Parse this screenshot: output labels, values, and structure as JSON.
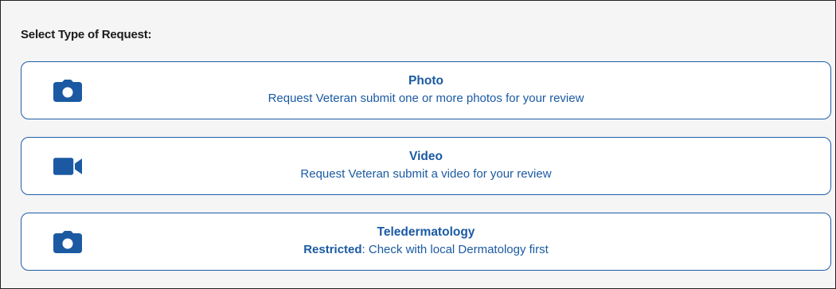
{
  "heading": "Select Type of Request:",
  "colors": {
    "accent": "#1b5aa2",
    "panel_background": "#f5f5f5",
    "card_border": "#1f5ea8"
  },
  "options": [
    {
      "icon": "camera-icon",
      "title": "Photo",
      "description": "Request Veteran submit one or more photos for your review"
    },
    {
      "icon": "video-camera-icon",
      "title": "Video",
      "description": "Request Veteran submit a video for your review"
    },
    {
      "icon": "camera-icon",
      "title": "Teledermatology",
      "description_emphasis": "Restricted",
      "description": ": Check with local Dermatology first"
    }
  ]
}
